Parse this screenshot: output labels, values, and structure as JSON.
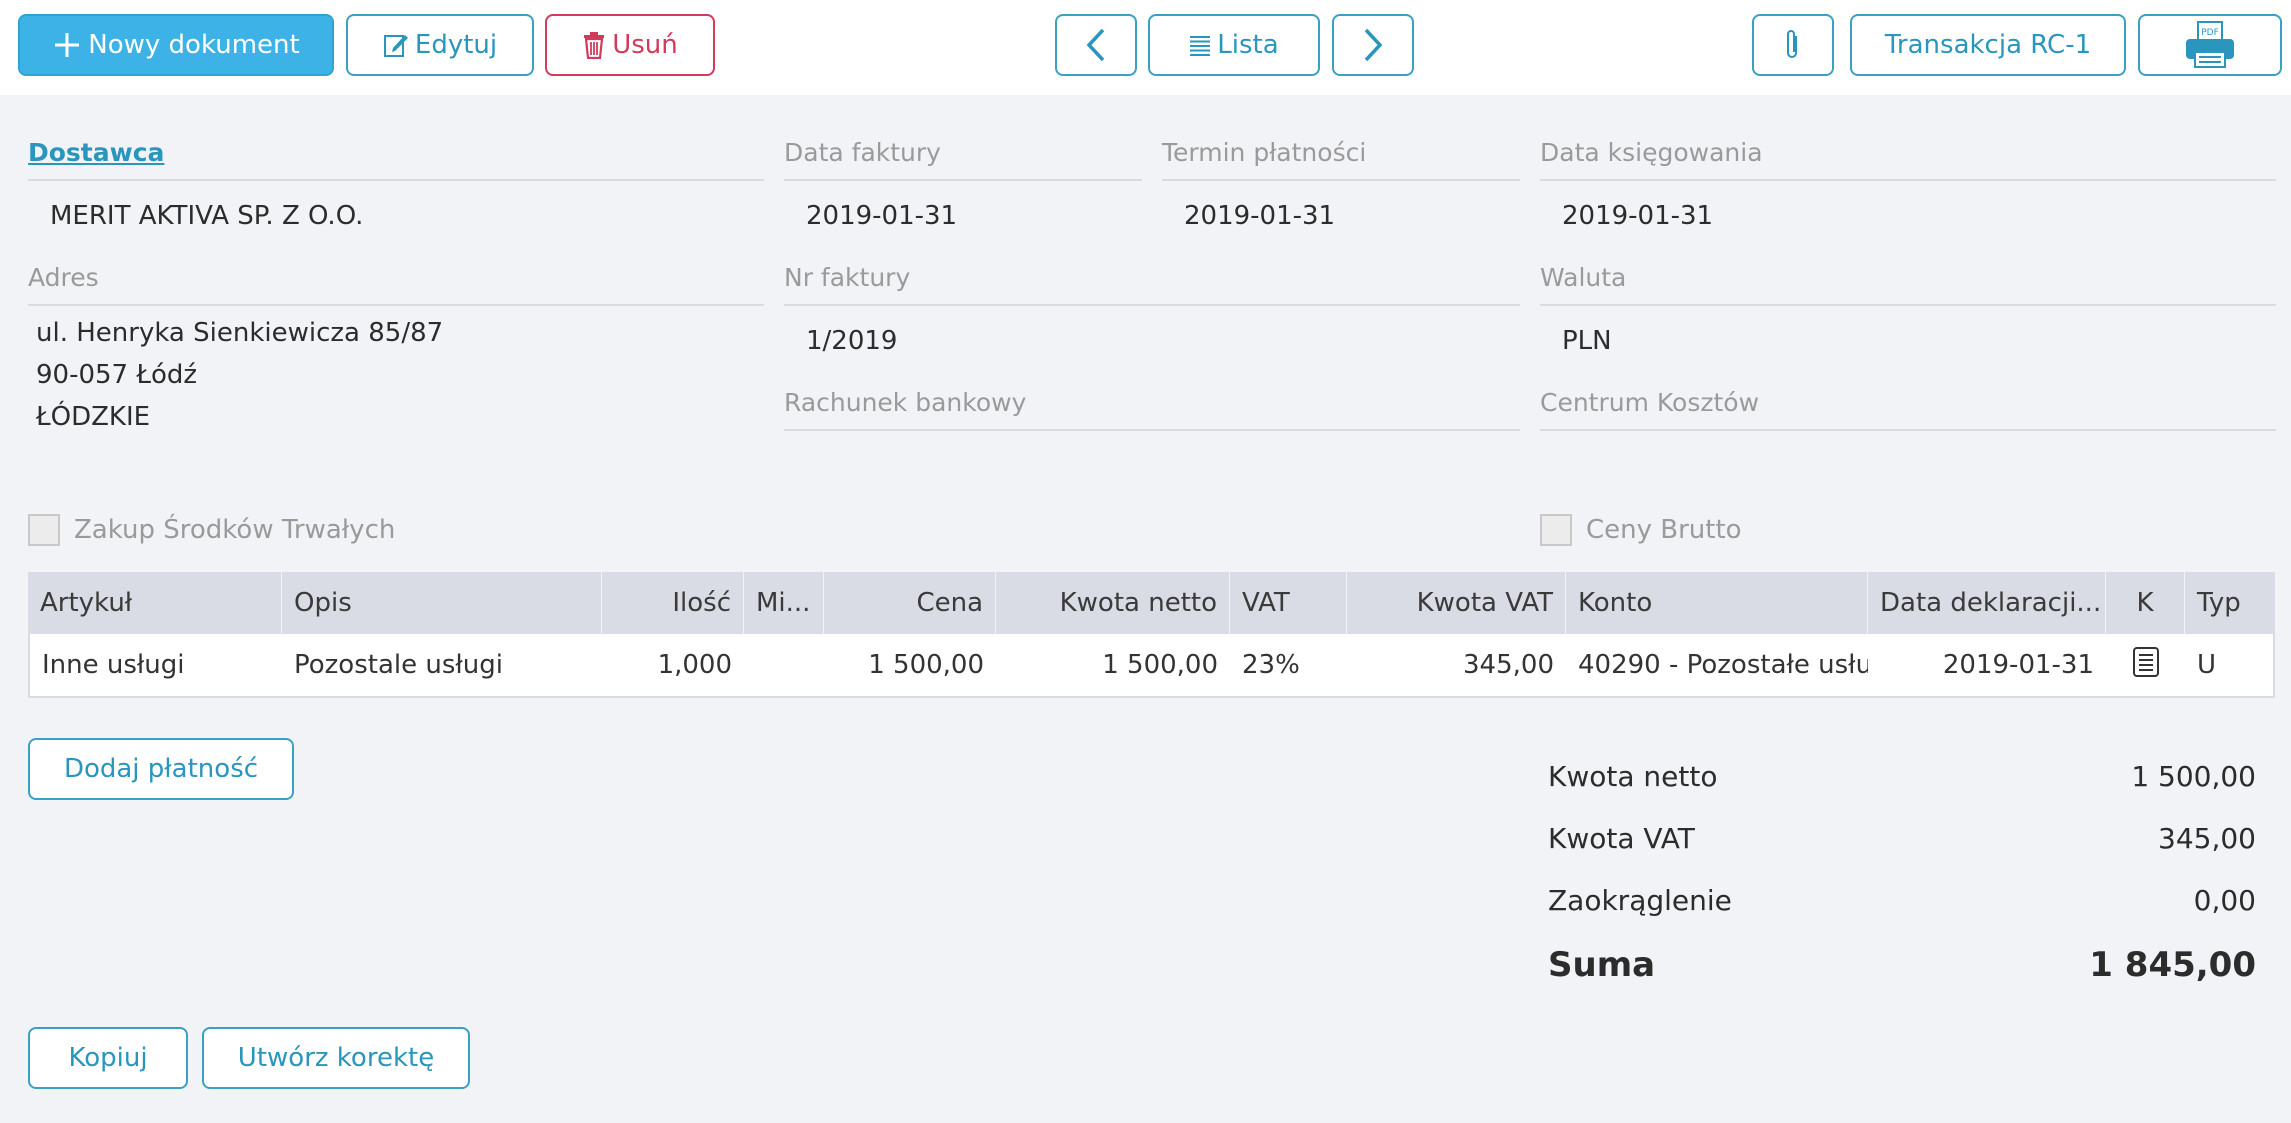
{
  "toolbar": {
    "new_doc": "Nowy dokument",
    "edit": "Edytuj",
    "delete": "Usuń",
    "list": "Lista",
    "transaction": "Transakcja RC-1",
    "pdf_icon_text": "PDF"
  },
  "form": {
    "supplier_label": "Dostawca",
    "supplier_value": "MERIT AKTIVA SP. Z O.O.",
    "invoice_date_label": "Data faktury",
    "invoice_date_value": "2019-01-31",
    "due_date_label": "Termin płatności",
    "due_date_value": "2019-01-31",
    "posting_date_label": "Data księgowania",
    "posting_date_value": "2019-01-31",
    "address_label": "Adres",
    "address_lines": [
      "ul. Henryka Sienkiewicza 85/87",
      "90-057 Łódź",
      "ŁÓDZKIE"
    ],
    "invoice_no_label": "Nr faktury",
    "invoice_no_value": "1/2019",
    "currency_label": "Waluta",
    "currency_value": "PLN",
    "bank_account_label": "Rachunek bankowy",
    "cost_center_label": "Centrum Kosztów",
    "fixed_assets_label": "Zakup Środków Trwałych",
    "gross_prices_label": "Ceny Brutto"
  },
  "table": {
    "headers": [
      "Artykuł",
      "Opis",
      "Ilość",
      "Mi...",
      "Cena",
      "Kwota netto",
      "VAT",
      "Kwota VAT",
      "Konto",
      "Data deklaracji...",
      "K",
      "Typ"
    ],
    "rows": [
      [
        "Inne usługi",
        "Pozostale usługi",
        "1,000",
        "",
        "1 500,00",
        "1 500,00",
        "23%",
        "345,00",
        "40290 - Pozostałe usłu",
        "2019-01-31",
        "",
        "U"
      ]
    ]
  },
  "buttons": {
    "add_payment": "Dodaj płatność",
    "copy": "Kopiuj",
    "create_correction": "Utwórz korektę"
  },
  "summary": {
    "net_label": "Kwota netto",
    "net_value": "1 500,00",
    "vat_label": "Kwota VAT",
    "vat_value": "345,00",
    "rounding_label": "Zaokrąglenie",
    "rounding_value": "0,00",
    "total_label": "Suma",
    "total_value": "1 845,00"
  },
  "colors": {
    "accent": "#3db2e6",
    "link": "#2a95bd",
    "danger": "#d23b5a",
    "background": "#f2f3f7"
  }
}
